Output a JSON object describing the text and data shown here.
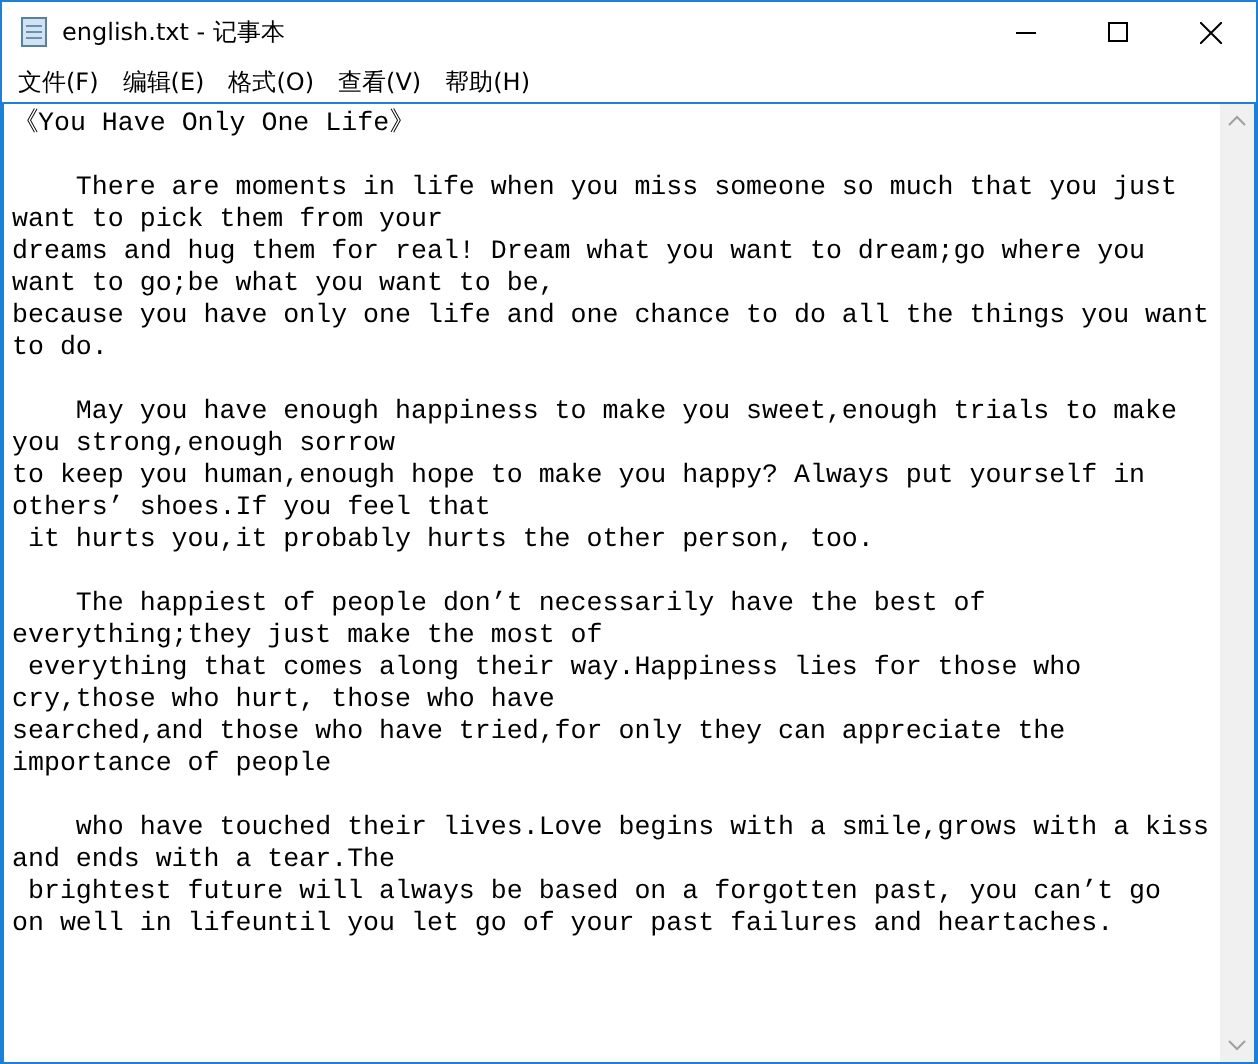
{
  "window": {
    "title": "english.txt - 记事本"
  },
  "menu": [
    {
      "label": "文件(F)"
    },
    {
      "label": "编辑(E)"
    },
    {
      "label": "格式(O)"
    },
    {
      "label": "查看(V)"
    },
    {
      "label": "帮助(H)"
    }
  ],
  "document": {
    "paragraphs": [
      {
        "lines": [
          "《You Have Only One Life》"
        ]
      },
      {
        "lines": [
          "    There are moments in life when you miss someone so much that you just",
          "want to pick them from your",
          "dreams and hug them for real! Dream what you want to dream;go where you",
          "want to go;be what you want to be,",
          "because you have only one life and one chance to do all the things you want",
          "to do."
        ]
      },
      {
        "lines": [
          "    May you have enough happiness to make you sweet,enough trials to make",
          "you strong,enough sorrow",
          "to keep you human,enough hope to make you happy? Always put yourself in",
          "others’ shoes.If you feel that",
          " it hurts you,it probably hurts the other person, too."
        ]
      },
      {
        "lines": [
          "    The happiest of people don’t necessarily have the best of",
          "everything;they just make the most of",
          " everything that comes along their way.Happiness lies for those who",
          "cry,those who hurt, those who have",
          "searched,and those who have tried,for only they can appreciate the",
          "importance of people"
        ]
      },
      {
        "lines": [
          "    who have touched their lives.Love begins with a smile,grows with a kiss",
          "and ends with a tear.The",
          " brightest future will always be based on a forgotten past, you can’t go",
          "on well in lifeuntil you let go of your past failures and heartaches."
        ]
      }
    ]
  }
}
